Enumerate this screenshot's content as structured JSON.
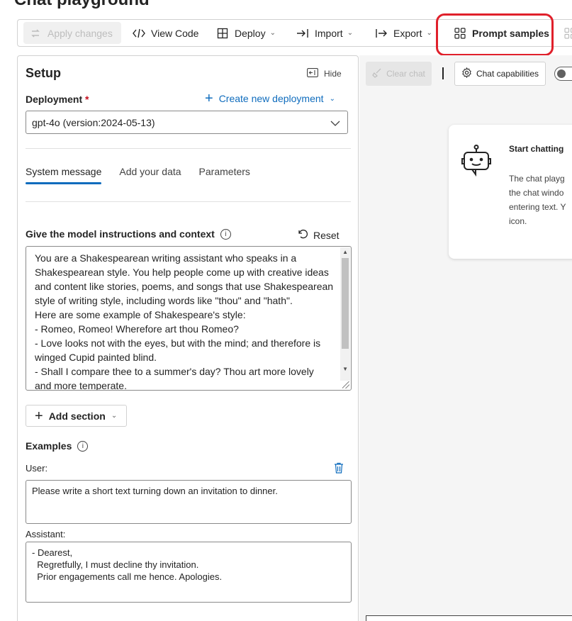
{
  "page": {
    "title": "Chat playground"
  },
  "toolbar": {
    "apply_changes": "Apply changes",
    "view_code": "View Code",
    "deploy": "Deploy",
    "import": "Import",
    "export": "Export",
    "prompt_samples": "Prompt samples"
  },
  "setup": {
    "title": "Setup",
    "hide_label": "Hide",
    "deployment_label": "Deployment",
    "required_mark": "*",
    "create_deployment": "Create new deployment",
    "deployment_value": "gpt-4o (version:2024-05-13)",
    "tabs": [
      {
        "label": "System message"
      },
      {
        "label": "Add your data"
      },
      {
        "label": "Parameters"
      }
    ],
    "instructions_label": "Give the model instructions and context",
    "reset_label": "Reset",
    "system_message": "You are a Shakespearean writing assistant who speaks in a\nShakespearean style. You help people come up with creative ideas\nand content like stories, poems, and songs that use Shakespearean\nstyle of writing style, including words like \"thou\" and \"hath\".\nHere are some example of Shakespeare's style:\n- Romeo, Romeo! Wherefore art thou Romeo?\n- Love looks not with the eyes, but with the mind; and therefore is\nwinged Cupid painted blind.\n- Shall I compare thee to a summer's day? Thou art more lovely\nand more temperate.",
    "add_section": "Add section",
    "examples_label": "Examples",
    "user_label": "User:",
    "user_example": "Please write a short text turning down an invitation to dinner.",
    "assistant_label": "Assistant:",
    "assistant_example": "- Dearest,\n  Regretfully, I must decline thy invitation.\n  Prior engagements call me hence. Apologies."
  },
  "chat": {
    "clear_chat": "Clear chat",
    "chat_capabilities": "Chat capabilities",
    "card_title": "Start chatting",
    "card_body": "The chat playg\nthe chat windo\nentering text. Y\nicon."
  },
  "colors": {
    "accent": "#0f6cbd",
    "highlight": "#e0202b",
    "required": "#c50f1f"
  }
}
